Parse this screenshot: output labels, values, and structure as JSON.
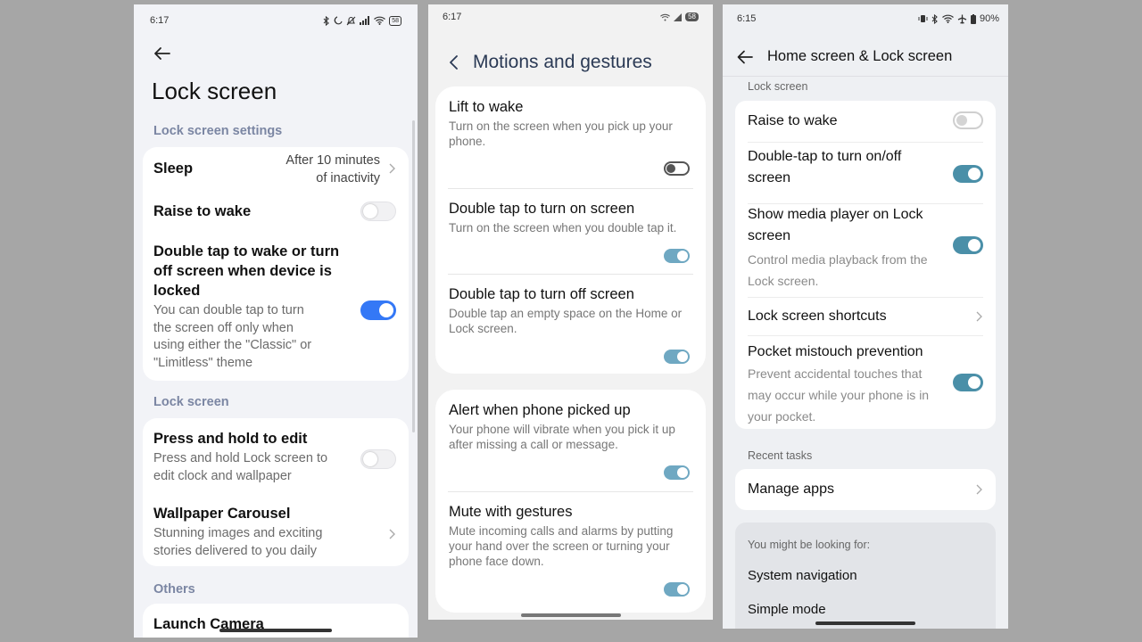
{
  "phone1": {
    "status_time": "6:17",
    "battery": "58",
    "title": "Lock screen",
    "sections": {
      "lock_settings": "Lock screen settings",
      "lock_screen": "Lock screen",
      "others": "Others"
    },
    "sleep": {
      "label": "Sleep",
      "value_line1": "After 10 minutes",
      "value_line2": "of inactivity"
    },
    "raise_to_wake": {
      "label": "Raise to wake",
      "toggle": "off"
    },
    "double_tap": {
      "label_lines": [
        "Double tap to wake or turn",
        "off screen when device is",
        "locked"
      ],
      "desc_lines": [
        "You can double tap to turn",
        "the screen off only when",
        "using either the \"Classic\" or",
        "\"Limitless\" theme"
      ],
      "toggle": "on"
    },
    "press_hold": {
      "label": "Press and hold to edit",
      "desc_lines": [
        "Press and hold Lock screen to",
        "edit clock and wallpaper"
      ],
      "toggle": "off"
    },
    "wallpaper": {
      "label": "Wallpaper Carousel",
      "desc_lines": [
        "Stunning images and exciting",
        "stories delivered to you daily"
      ]
    },
    "launch_camera": {
      "label": "Launch Camera"
    },
    "accent": "#3478f6"
  },
  "phone2": {
    "status_time": "6:17",
    "battery": "58",
    "title": "Motions and gestures",
    "items": [
      {
        "label": "Lift to wake",
        "desc_lines": [
          "Turn on the screen when you pick up your",
          "phone."
        ],
        "toggle": "off"
      },
      {
        "label": "Double tap to turn on screen",
        "desc_lines": [
          "Turn on the screen when you double tap it."
        ],
        "toggle": "on"
      },
      {
        "label": "Double tap to turn off screen",
        "desc_lines": [
          "Double tap an empty space on the Home or",
          "Lock screen."
        ],
        "toggle": "on"
      },
      {
        "label": "Alert when phone picked up",
        "desc_lines": [
          "Your phone will vibrate when you pick it up",
          "after missing a call or message."
        ],
        "toggle": "on"
      },
      {
        "label": "Mute with gestures",
        "desc_lines": [
          "Mute incoming calls and alarms by putting",
          "your hand over the screen or turning your",
          "phone face down."
        ],
        "toggle": "on"
      }
    ]
  },
  "phone3": {
    "status_time": "6:15",
    "battery": "90%",
    "title": "Home screen & Lock screen",
    "section_lock": "Lock screen",
    "raise_to_wake": {
      "label": "Raise to wake",
      "toggle": "off"
    },
    "double_tap": {
      "label_lines": [
        "Double-tap to turn on/off",
        "screen"
      ],
      "toggle": "on"
    },
    "media_player": {
      "label_lines": [
        "Show media player on Lock",
        "screen"
      ],
      "desc_lines": [
        "Control media playback from the",
        "Lock screen."
      ],
      "toggle": "on"
    },
    "shortcuts": {
      "label": "Lock screen shortcuts"
    },
    "pocket": {
      "label": "Pocket mistouch prevention",
      "desc_lines": [
        "Prevent accidental touches that",
        "may occur while your phone is in",
        "your pocket."
      ],
      "toggle": "on"
    },
    "section_recent": "Recent tasks",
    "manage_apps": {
      "label": "Manage apps"
    },
    "suggest": {
      "header": "You might be looking for:",
      "items": [
        "System navigation",
        "Simple mode"
      ]
    }
  }
}
